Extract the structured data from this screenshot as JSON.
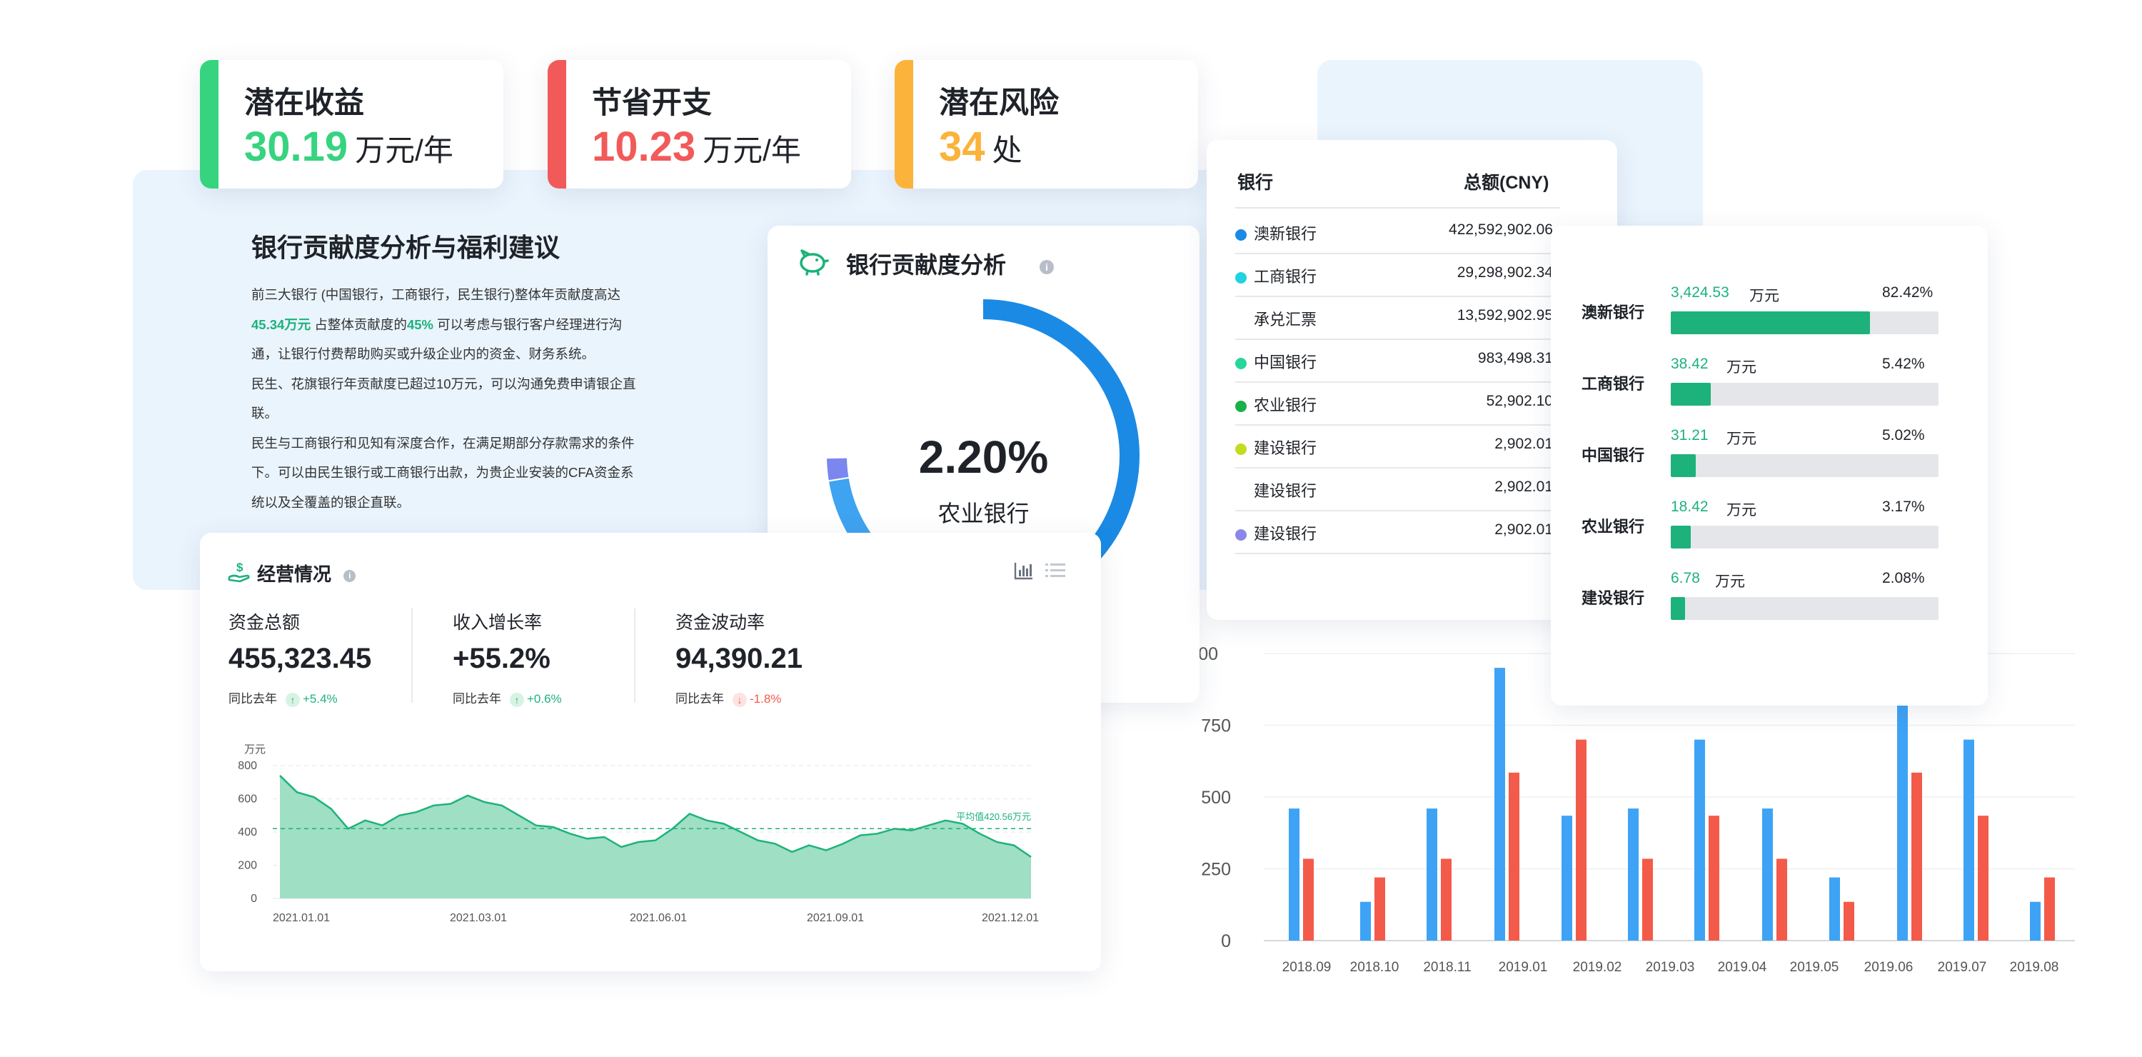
{
  "kpis": [
    {
      "title": "潜在收益",
      "value": "30.19",
      "unit": "万元/年",
      "color": "#36d47f"
    },
    {
      "title": "节省开支",
      "value": "10.23",
      "unit": "万元/年",
      "color": "#f25a5a"
    },
    {
      "title": "潜在风险",
      "value": "34",
      "unit": "处",
      "color": "#fbb33b"
    }
  ],
  "advice": {
    "title": "银行贡献度分析与福利建议",
    "p1_a": "前三大银行 (中国银行，工商银行，民生银行)整体年贡献度高达",
    "p1_h1": "45.34万元",
    "p1_b": " 占整体贡献度的",
    "p1_h2": "45%",
    "p1_c": " 可以考虑与银行客户经理进行沟通，让银行付费帮助购买或升级企业内的资金、财务系统。",
    "p2": "民生、花旗银行年贡献度已超过10万元，可以沟通免费申请银企直联。",
    "p3": "民生与工商银行和见知有深度合作，在满足期部分存款需求的条件下。可以由民生银行或工商银行出款，为贵企业安装的CFA资金系统以及全覆盖的银企直联。"
  },
  "donut": {
    "title": "银行贡献度分析",
    "info": "i",
    "center_value": "2.20%",
    "center_label": "农业银行",
    "segments": [
      {
        "value": 38,
        "color": "#1a8ae5"
      },
      {
        "value": 22,
        "color": "#9bd22a"
      },
      {
        "value": 12,
        "color": "#3ea3f0"
      },
      {
        "value": 2.2,
        "color": "#7b86ee"
      }
    ]
  },
  "table": {
    "col_bank": "银行",
    "col_amount": "总额(CNY)",
    "rows": [
      {
        "name": "澳新银行",
        "amount": "422,592,902.06",
        "dot": "#1a8ae5"
      },
      {
        "name": "工商银行",
        "amount": "29,298,902.34",
        "dot": "#22d2e0"
      },
      {
        "name": "承兑汇票",
        "amount": "13,592,902.95",
        "dot": ""
      },
      {
        "name": "中国银行",
        "amount": "983,498.31",
        "dot": "#28d69a"
      },
      {
        "name": "农业银行",
        "amount": "52,902.10",
        "dot": "#17b04a"
      },
      {
        "name": "建设银行",
        "amount": "2,902.01",
        "dot": "#c3dc20"
      },
      {
        "name": "建设银行",
        "amount": "2,902.01",
        "dot": ""
      },
      {
        "name": "建设银行",
        "amount": "2,902.01",
        "dot": "#8a88e6"
      }
    ]
  },
  "progress": {
    "unit": "万元",
    "items": [
      {
        "name": "澳新银行",
        "value": "3,424.53",
        "pct": "82.42%",
        "fraction": 0.7445
      },
      {
        "name": "工商银行",
        "value": "38.42",
        "pct": "5.42%",
        "fraction": 0.15
      },
      {
        "name": "中国银行",
        "value": "31.21",
        "pct": "5.02%",
        "fraction": 0.094
      },
      {
        "name": "农业银行",
        "value": "18.42",
        "pct": "3.17%",
        "fraction": 0.075
      },
      {
        "name": "建设银行",
        "value": "6.78",
        "pct": "2.08%",
        "fraction": 0.054
      }
    ]
  },
  "ops": {
    "title": "经营情况",
    "info": "i",
    "compare_label": "同比去年",
    "metrics": [
      {
        "label": "资金总额",
        "value": "455,323.45",
        "change": "+5.4%",
        "dir": "up"
      },
      {
        "label": "收入增长率",
        "value": "+55.2%",
        "change": "+0.6%",
        "dir": "up"
      },
      {
        "label": "资金波动率",
        "value": "94,390.21",
        "change": "-1.8%",
        "dir": "down"
      }
    ]
  },
  "chart_data": [
    {
      "type": "area",
      "ylabel": "万元",
      "ylim": [
        0,
        800
      ],
      "yticks": [
        0,
        200,
        400,
        600,
        800
      ],
      "x_labels": [
        "2021.01.01",
        "2021.03.01",
        "2021.06.01",
        "2021.09.01",
        "2021.12.01"
      ],
      "values": [
        740,
        640,
        610,
        540,
        420,
        470,
        440,
        500,
        520,
        560,
        570,
        620,
        580,
        560,
        500,
        440,
        430,
        390,
        360,
        370,
        310,
        340,
        350,
        420,
        510,
        470,
        450,
        400,
        350,
        330,
        280,
        320,
        290,
        330,
        380,
        390,
        420,
        410,
        440,
        470,
        450,
        390,
        340,
        320,
        250
      ],
      "average": 420.56,
      "average_label": "平均值420.56万元",
      "color": "#1db27b",
      "fill": "#9fdfc4"
    },
    {
      "type": "bar",
      "categories": [
        "2018.09",
        "2018.10",
        "2018.11",
        "2019.01",
        "2019.02",
        "2019.03",
        "2019.04",
        "2019.05",
        "2019.06",
        "2019.07",
        "2019.08"
      ],
      "series": [
        {
          "values": [
            460,
            135,
            460,
            950,
            435,
            460,
            700,
            460,
            220,
            1000,
            700,
            135
          ]
        },
        {
          "values": [
            285,
            220,
            285,
            585,
            700,
            285,
            435,
            285,
            135,
            585,
            435,
            220
          ]
        }
      ],
      "yticks": [
        0,
        250,
        500,
        750
      ],
      "ylim": [
        0,
        1000
      ],
      "top_tick_partial": "00",
      "colors": [
        "#3ea3f5",
        "#f45a4a"
      ]
    }
  ]
}
